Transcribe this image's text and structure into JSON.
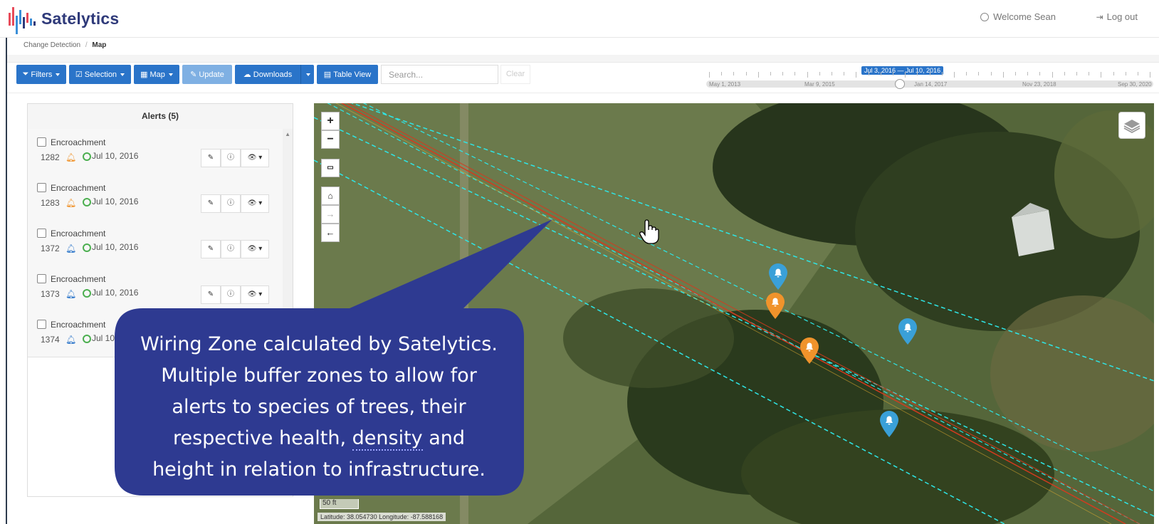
{
  "app": {
    "brand": "Satelytics",
    "welcome": "Welcome Sean",
    "logout": "Log out"
  },
  "breadcrumb": {
    "parent": "Change Detection",
    "separator": "/",
    "current": "Map"
  },
  "toolbar": {
    "filters": "Filters",
    "selection": "Selection",
    "map": "Map",
    "update": "Update",
    "downloads": "Downloads",
    "table_view": "Table View",
    "search_placeholder": "Search...",
    "clear": "Clear"
  },
  "timeline": {
    "range": "Jul 3, 2016 — Jul 10, 2016",
    "labels": [
      "May 1, 2013",
      "Mar 9, 2015",
      "Jan 14, 2017",
      "Nov 23, 2018",
      "Sep 30, 2020"
    ]
  },
  "alerts": {
    "title": "Alerts (5)",
    "items": [
      {
        "type": "Encroachment",
        "id": "1282",
        "bell_color": "#f0932b",
        "date": "Jul 10, 2016"
      },
      {
        "type": "Encroachment",
        "id": "1283",
        "bell_color": "#f0932b",
        "date": "Jul 10, 2016"
      },
      {
        "type": "Encroachment",
        "id": "1372",
        "bell_color": "#2a74c9",
        "date": "Jul 10, 2016"
      },
      {
        "type": "Encroachment",
        "id": "1373",
        "bell_color": "#2a74c9",
        "date": "Jul 10, 2016"
      },
      {
        "type": "Encroachment",
        "id": "1374",
        "bell_color": "#2a74c9",
        "date": "Jul 10,"
      }
    ]
  },
  "map": {
    "scale": "50 ft",
    "coords": "Latitude: 38.054730 Longitude: -87.588168",
    "zoom_in": "+",
    "zoom_out": "−"
  },
  "callout": {
    "line1": "Wiring Zone calculated by Satelytics.",
    "line2": "Multiple buffer zones to allow for",
    "line3": "alerts to species of trees, their",
    "line4_pre": "respective health, ",
    "line4_dotted": "density",
    "line4_post": " and",
    "line5": "height in relation to infrastructure."
  },
  "colors": {
    "primary": "#2a74c9",
    "brand": "#2f3a7a",
    "callout_bg": "#2e3a91",
    "orange_marker": "#f0932b",
    "blue_marker": "#3aa0d8",
    "buffer_line": "#2ee6e6",
    "wire_line": "#d43a1f"
  }
}
